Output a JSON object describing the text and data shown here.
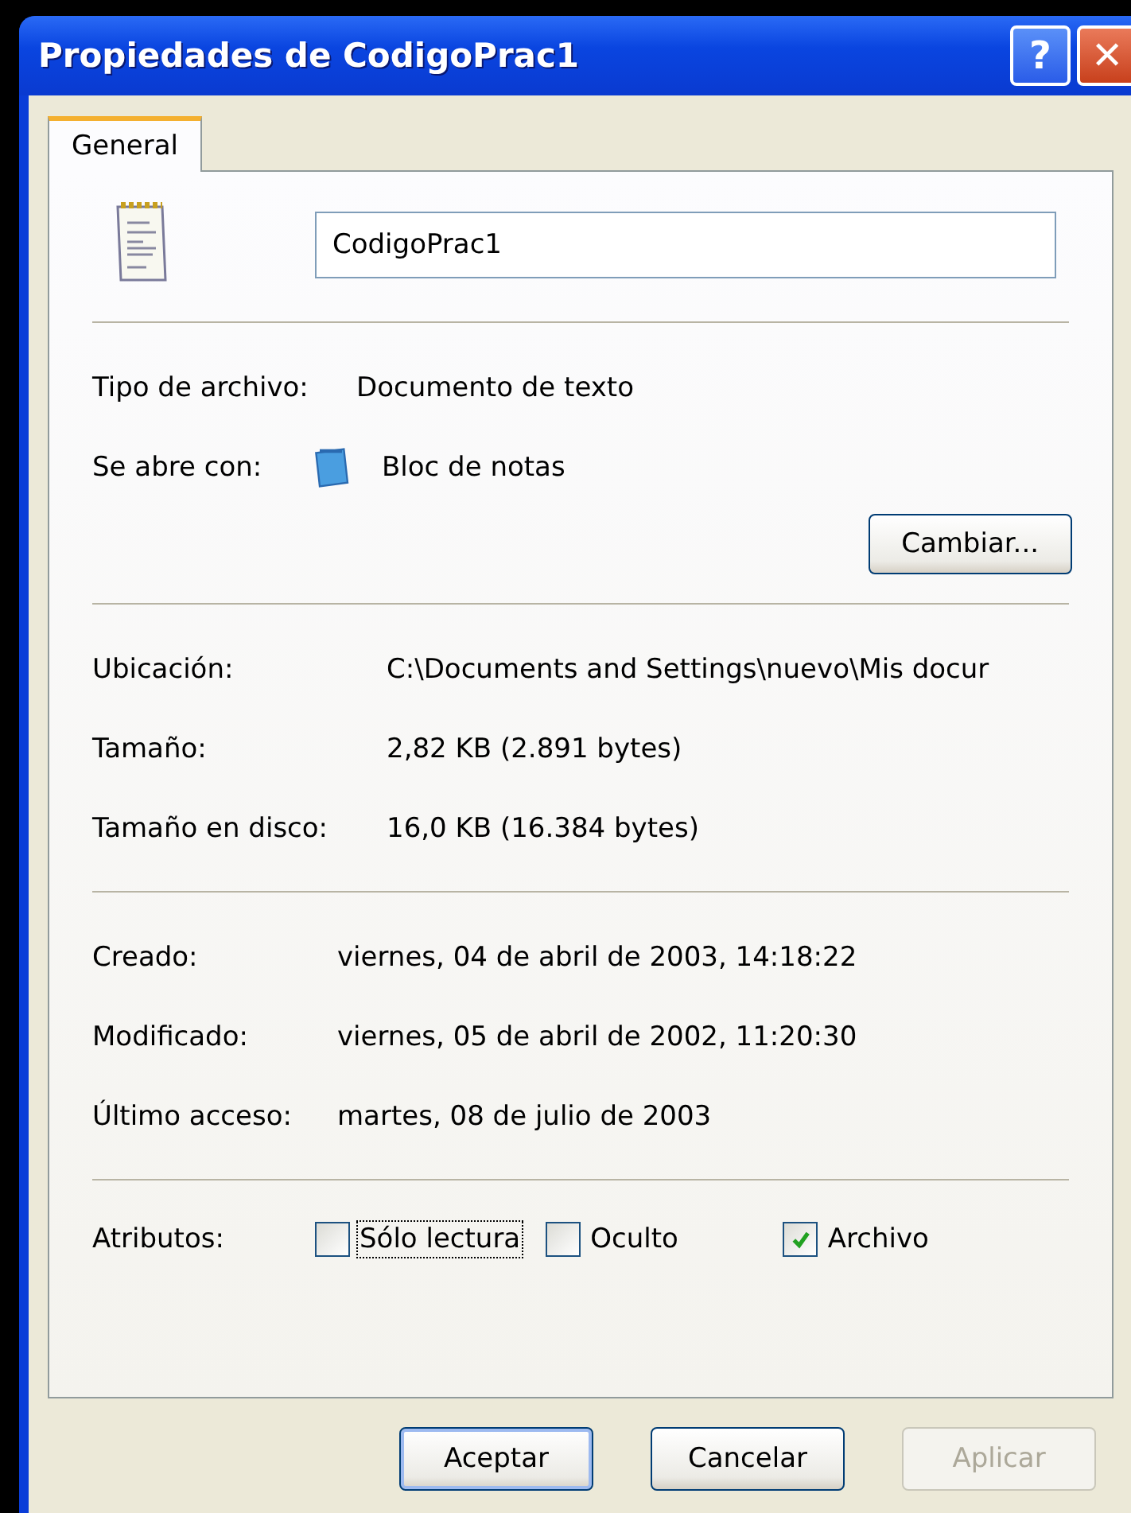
{
  "window": {
    "title": "Propiedades de CodigoPrac1",
    "help_button": "?",
    "close_button": "✕"
  },
  "tabs": [
    {
      "label": "General",
      "selected": true
    }
  ],
  "file_name": {
    "value": "CodigoPrac1"
  },
  "type_info": [
    {
      "label": "Tipo de archivo:",
      "value": "Documento de texto",
      "kind": "text"
    },
    {
      "label": "Se abre con:",
      "value": "Bloc de notas",
      "kind": "app"
    }
  ],
  "change_button": "Cambiar...",
  "location_info": [
    {
      "label": "Ubicación:",
      "value": "C:\\Documents and Settings\\nuevo\\Mis docur"
    },
    {
      "label": "Tamaño:",
      "value": "2,82 KB (2.891 bytes)"
    },
    {
      "label": "Tamaño en disco:",
      "value": "16,0 KB (16.384 bytes)"
    }
  ],
  "dates": [
    {
      "label": "Creado:",
      "value": "viernes, 04 de abril de 2003, 14:18:22"
    },
    {
      "label": "Modificado:",
      "value": "viernes, 05 de abril de 2002, 11:20:30"
    },
    {
      "label": "Último acceso:",
      "value": "martes, 08 de julio de 2003"
    }
  ],
  "attributes": {
    "label": "Atributos:",
    "items": [
      {
        "label": "Sólo lectura",
        "checked": false,
        "focused": true
      },
      {
        "label": "Oculto",
        "checked": false,
        "focused": false
      },
      {
        "label": "Archivo",
        "checked": true,
        "focused": false
      }
    ]
  },
  "buttons": [
    {
      "label": "Aceptar",
      "disabled": false,
      "default": true
    },
    {
      "label": "Cancelar",
      "disabled": false,
      "default": false
    },
    {
      "label": "Aplicar",
      "disabled": true,
      "default": false
    }
  ]
}
